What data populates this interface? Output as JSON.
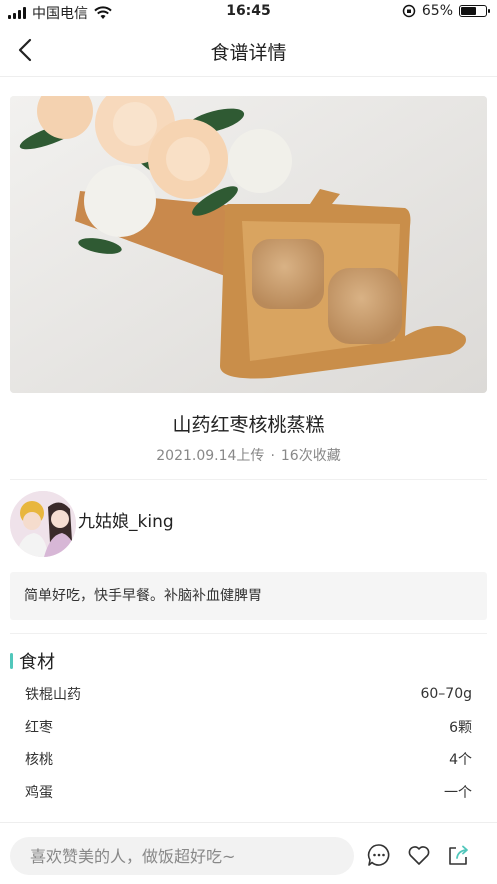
{
  "status_bar": {
    "carrier": "中国电信",
    "time": "16:45",
    "battery": "65%",
    "battery_level": 0.65
  },
  "nav": {
    "title": "食谱详情",
    "back_icon": "chevron-left-icon"
  },
  "recipe": {
    "title": "山药红枣核桃蒸糕",
    "upload_date": "2021.09.14上传",
    "separator": "·",
    "favorites": "16次收藏",
    "author": "九姑娘_king",
    "description": "简单好吃，快手早餐。补脑补血健脾胃"
  },
  "ingredients": {
    "heading": "食材",
    "accent_color": "#51c7bb",
    "items": [
      {
        "name": "铁棍山药",
        "amount": "60–70g"
      },
      {
        "name": "红枣",
        "amount": "6颗"
      },
      {
        "name": "核桃",
        "amount": "4个"
      },
      {
        "name": "鸡蛋",
        "amount": "一个"
      }
    ]
  },
  "bottom_bar": {
    "comment_placeholder": "喜欢赞美的人，做饭超好吃~",
    "icons": [
      "comment-icon",
      "heart-icon",
      "share-icon"
    ]
  }
}
